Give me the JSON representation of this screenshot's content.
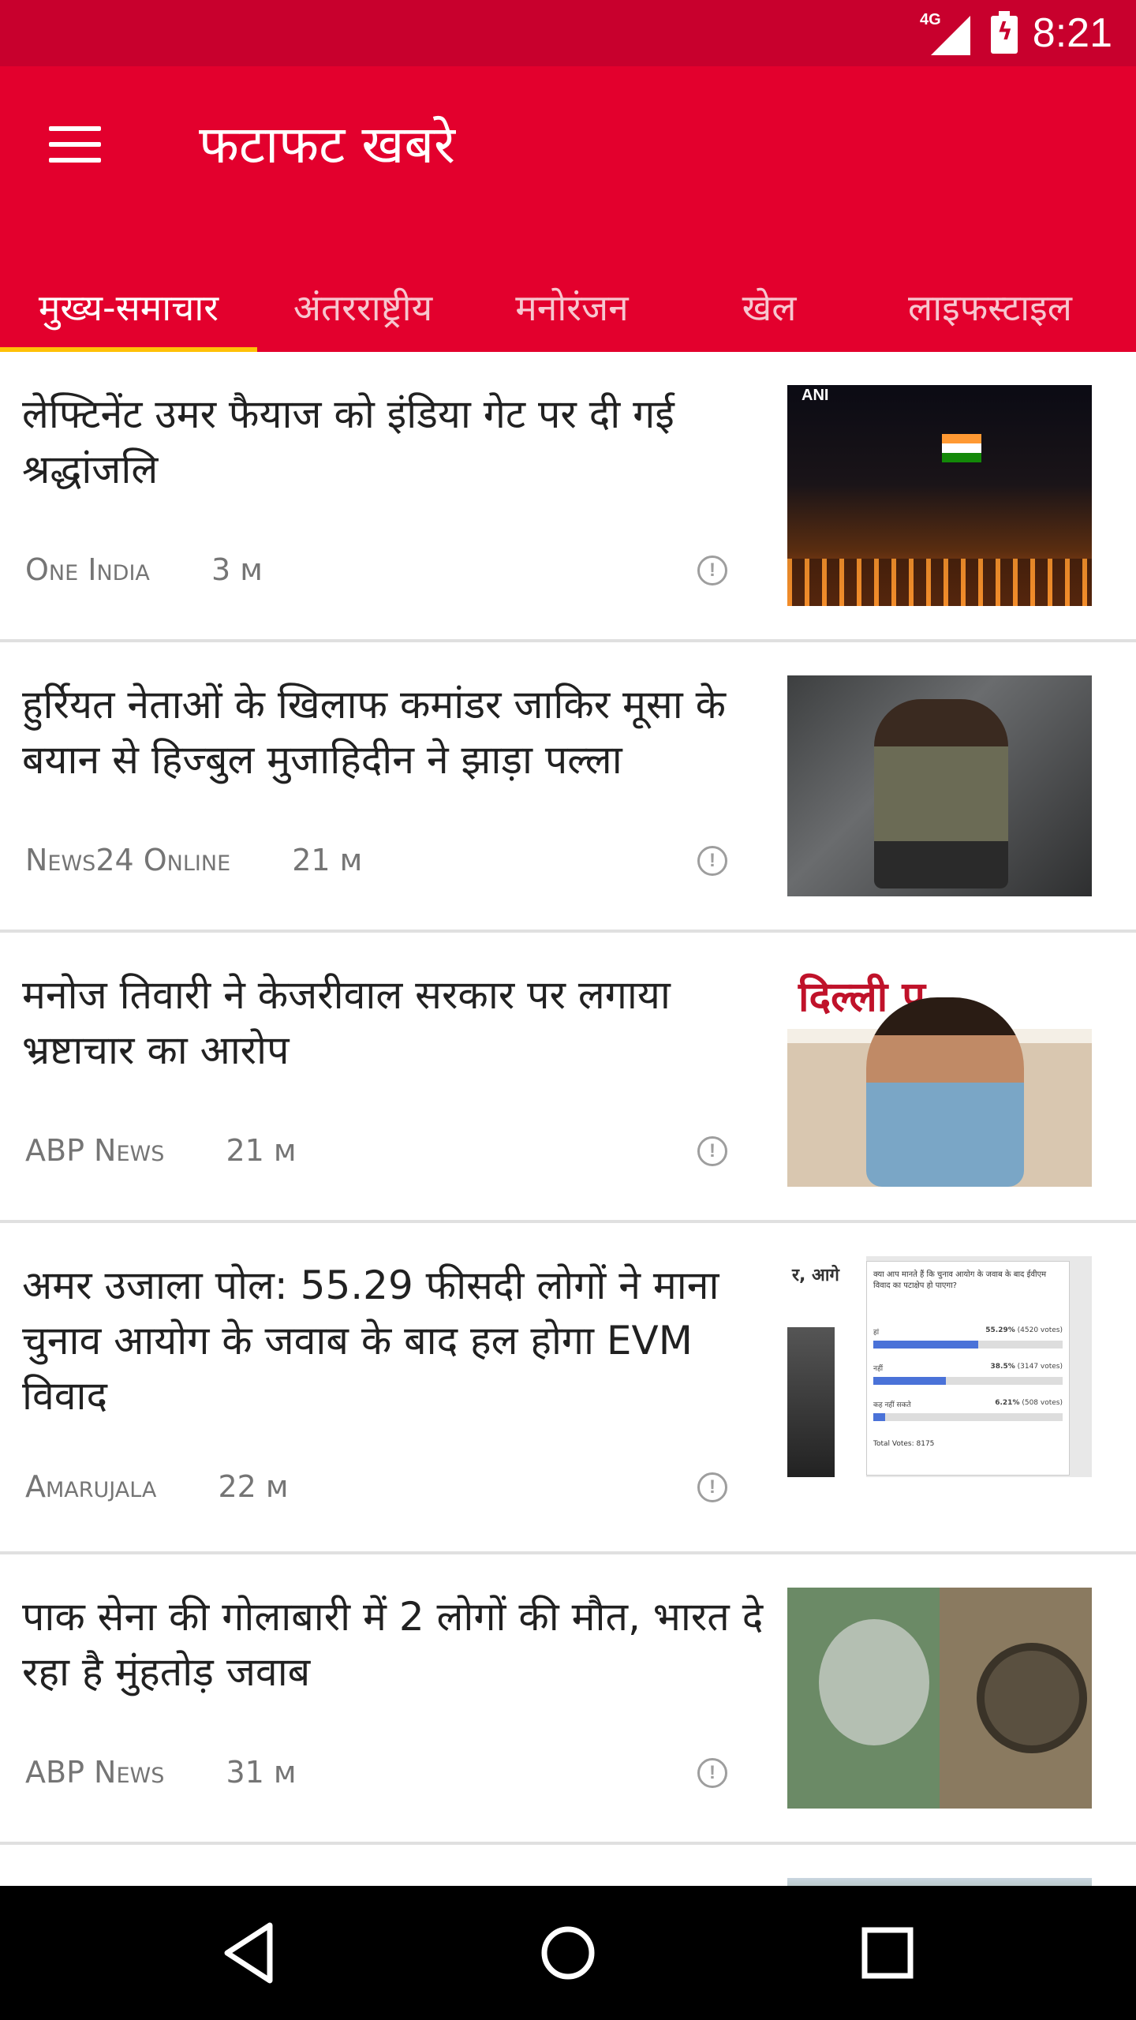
{
  "status_bar": {
    "time": "8:21",
    "network": "4G",
    "icons": [
      "signal-icon",
      "battery-charging-icon"
    ]
  },
  "app_bar": {
    "title": "फटाफट खबरे",
    "menu_icon": "hamburger-menu-icon"
  },
  "tabs": [
    {
      "label": "मुख्य-समाचार",
      "active": true
    },
    {
      "label": "अंतरराष्ट्रीय",
      "active": false
    },
    {
      "label": "मनोरंजन",
      "active": false
    },
    {
      "label": "खेल",
      "active": false
    },
    {
      "label": "लाइफस्टाइल",
      "active": false
    }
  ],
  "news": [
    {
      "title": "लेफ्टिनेंट उमर फैयाज को इंडिया गेट पर दी गई श्रद्धांजलि",
      "source": "One India",
      "time": "3 м",
      "thumb_caption": "ANI"
    },
    {
      "title": "हुर्रियत नेताओं के खिलाफ कमांडर जाकिर मूसा के बयान से हिज्बुल मुजाहिदीन ने झाड़ा पल्ला",
      "source": "News24 Online",
      "time": "21 м"
    },
    {
      "title": "मनोज तिवारी ने केजरीवाल सरकार पर लगाया भ्रष्टाचार का आरोप",
      "source": "ABP News",
      "time": "21 м",
      "thumb_caption": "दिल्ली प्र"
    },
    {
      "title": "अमर उजाला पोल: 55.29 फीसदी लोगों ने माना चुनाव आयोग के जवाब के बाद हल होगा EVM विवाद",
      "source": "Amarujala",
      "time": "22 м",
      "thumb_caption": "र, आगे"
    },
    {
      "title": "पाक सेना की गोलाबारी में 2 लोगों की मौत, भारत दे रहा है मुंहतोड़ जवाब",
      "source": "ABP News",
      "time": "31 м"
    }
  ],
  "poll_thumbnail": {
    "question": "क्या आप मानते हैं कि चुनाव आयोग के जवाब के बाद ईवीएम विवाद का पटाक्षेप हो पाएगा?",
    "options": [
      {
        "label": "हां",
        "percent": 55.29,
        "percent_text": "55.29%",
        "votes": "(4520 votes)"
      },
      {
        "label": "नहीं",
        "percent": 38.5,
        "percent_text": "38.5%",
        "votes": "(3147 votes)"
      },
      {
        "label": "कह नहीं सकते",
        "percent": 6.21,
        "percent_text": "6.21%",
        "votes": "(508 votes)"
      }
    ],
    "total": "Total Votes: 8175"
  },
  "colors": {
    "status_bar": "#c8002d",
    "app_bar": "#e3002d",
    "tab_indicator": "#ffc107"
  },
  "nav_bar": {
    "buttons": [
      "back-icon",
      "home-icon",
      "recents-icon"
    ]
  }
}
